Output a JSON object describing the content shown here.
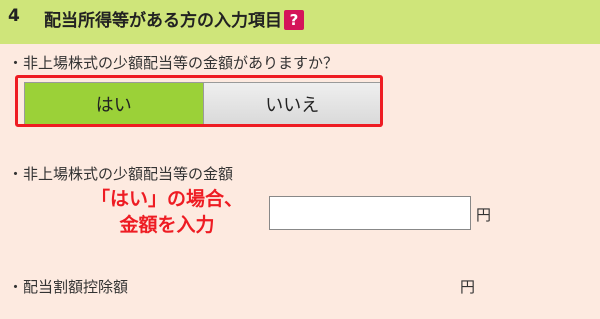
{
  "header": {
    "number": "4",
    "title": "配当所得等がある方の入力項目",
    "help_icon_glyph": "?"
  },
  "fields": {
    "q1_label": "・非上場株式の少額配当等の金額がありますか？",
    "q1_options": {
      "yes": "はい",
      "no": "いいえ"
    },
    "q2_label": "・非上場株式の少額配当等の金額",
    "q2_value": "",
    "q2_unit": "円",
    "q3_label": "・配当割額控除額",
    "q3_unit": "円"
  },
  "annotation": {
    "line1": "「はい」の場合、",
    "line2": "金額を入力"
  }
}
